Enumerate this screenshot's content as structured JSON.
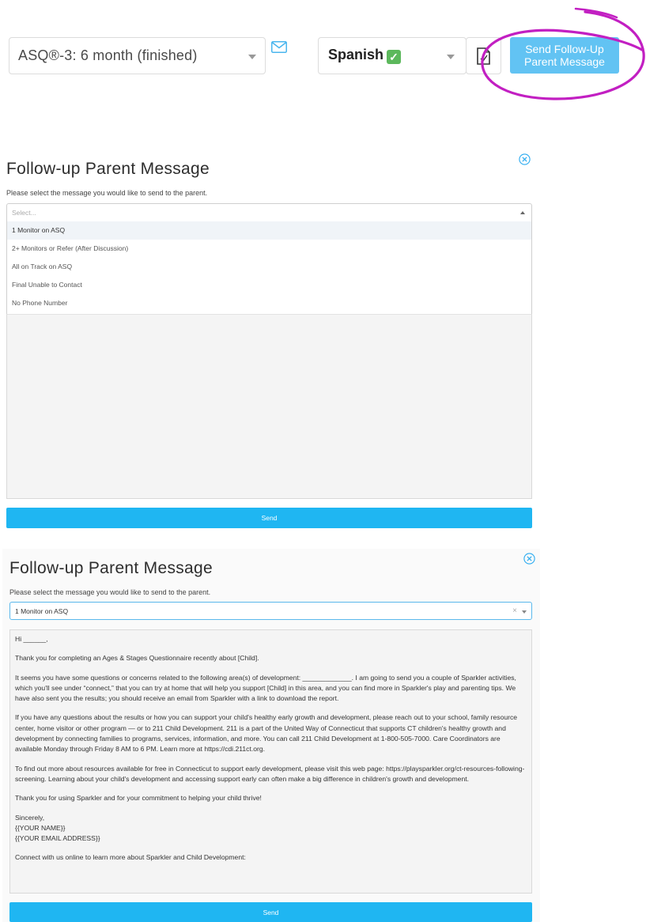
{
  "toolbar": {
    "assessment_value": "ASQ®-3: 6 month (finished)",
    "language_value": "Spanish",
    "language_check_icon": "check-mark-icon",
    "mail_icon": "envelope-icon",
    "document_icon": "document-icon",
    "followup_button_label": "Send Follow-Up Parent Message"
  },
  "modal1": {
    "title": "Follow-up Parent Message",
    "instruction": "Please select the message you would like to send to the parent.",
    "select_placeholder": "Select...",
    "options": [
      "1 Monitor on ASQ",
      "2+ Monitors or Refer (After Discussion)",
      "All on Track on ASQ",
      "Final Unable to Contact",
      "No Phone Number"
    ],
    "send_label": "Send"
  },
  "modal2": {
    "title": "Follow-up Parent Message",
    "instruction": "Please select the message you would like to send to the parent.",
    "select_value": "1 Monitor on ASQ",
    "message_lines": [
      "Hi ______,",
      "Thank you for completing an Ages & Stages Questionnaire recently about [Child].",
      "It seems you have some questions or concerns related to the following area(s) of development: _____________. I am going to send you a couple of Sparkler activities, which you'll see under “connect,” that you can try at home that will help you support [Child] in this area, and you can find more in Sparkler's play and parenting tips. We have also sent you the results; you should receive an email from Sparkler with a link to download the report.",
      "If you have any questions about the results or how you can support your child's healthy early growth and development, please reach out to your school, family resource center, home visitor or other program — or to 211 Child Development. 211 is a part of the United Way of Connecticut that supports CT children's healthy growth and development by connecting families to programs, services, information, and more. You can call 211 Child Development at 1-800-505-7000. Care Coordinators are available Monday through Friday 8 AM to 6 PM. Learn more at https://cdi.211ct.org.",
      "To find out more about resources available for free in Connecticut to support early development, please visit this web page: https://playsparkler.org/ct-resources-following-screening. Learning about your child's development and accessing support early can often make a big difference in children's growth and development.",
      "Thank you for using Sparkler and for your commitment to helping your child thrive!"
    ],
    "signoff": "Sincerely,",
    "sig_name": "{{YOUR NAME}}",
    "sig_email": "{{YOUR EMAIL ADDRESS}}",
    "trailing_line": "Connect with us online to learn more about Sparkler and Child Development:",
    "send_label": "Send"
  },
  "colors": {
    "accent_blue": "#1fb6f2",
    "followup_button": "#62c3f3",
    "annotation_magenta": "#c21fc2"
  }
}
